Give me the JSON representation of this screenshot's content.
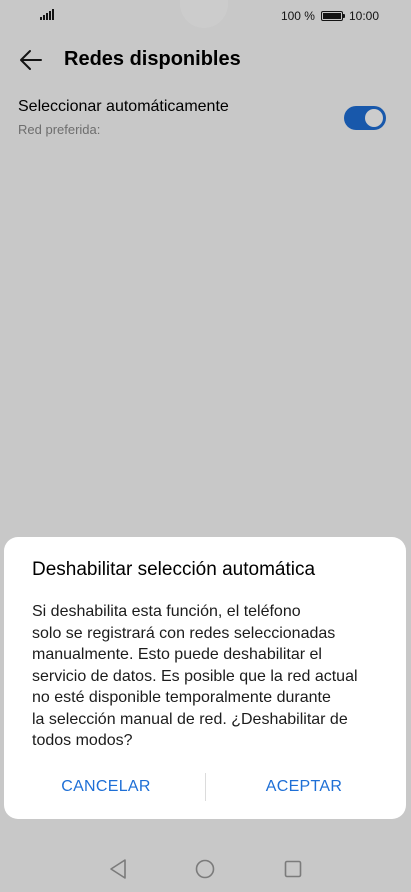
{
  "status_bar": {
    "battery_text": "100 %",
    "battery_level": 1.0,
    "time": "10:00",
    "signal_icon": "signal-bars-icon",
    "battery_icon": "battery-icon"
  },
  "toolbar": {
    "back_icon": "arrow-left-icon",
    "title": "Redes disponibles"
  },
  "preference": {
    "title": "Seleccionar automáticamente",
    "subtitle": "Red preferida:",
    "toggle_on": true
  },
  "dialog": {
    "title": "Deshabilitar selección automática",
    "message_lines": [
      "Si deshabilita esta función, el teléfono",
      "solo se registrará con redes seleccionadas",
      "manualmente. Esto puede deshabilitar el",
      "servicio de datos. Es posible que la red actual",
      "no esté disponible temporalmente durante",
      "la selección manual de red. ¿Deshabilitar de",
      "todos modos?"
    ],
    "cancel_label": "CANCELAR",
    "accept_label": "ACEPTAR"
  },
  "nav_bar": {
    "back_icon": "triangle-back-icon",
    "home_icon": "circle-home-icon",
    "recent_icon": "square-recents-icon"
  },
  "colors": {
    "accent": "#1e6fd6",
    "scrim": "#000000",
    "dialog_background": "#ffffff"
  }
}
